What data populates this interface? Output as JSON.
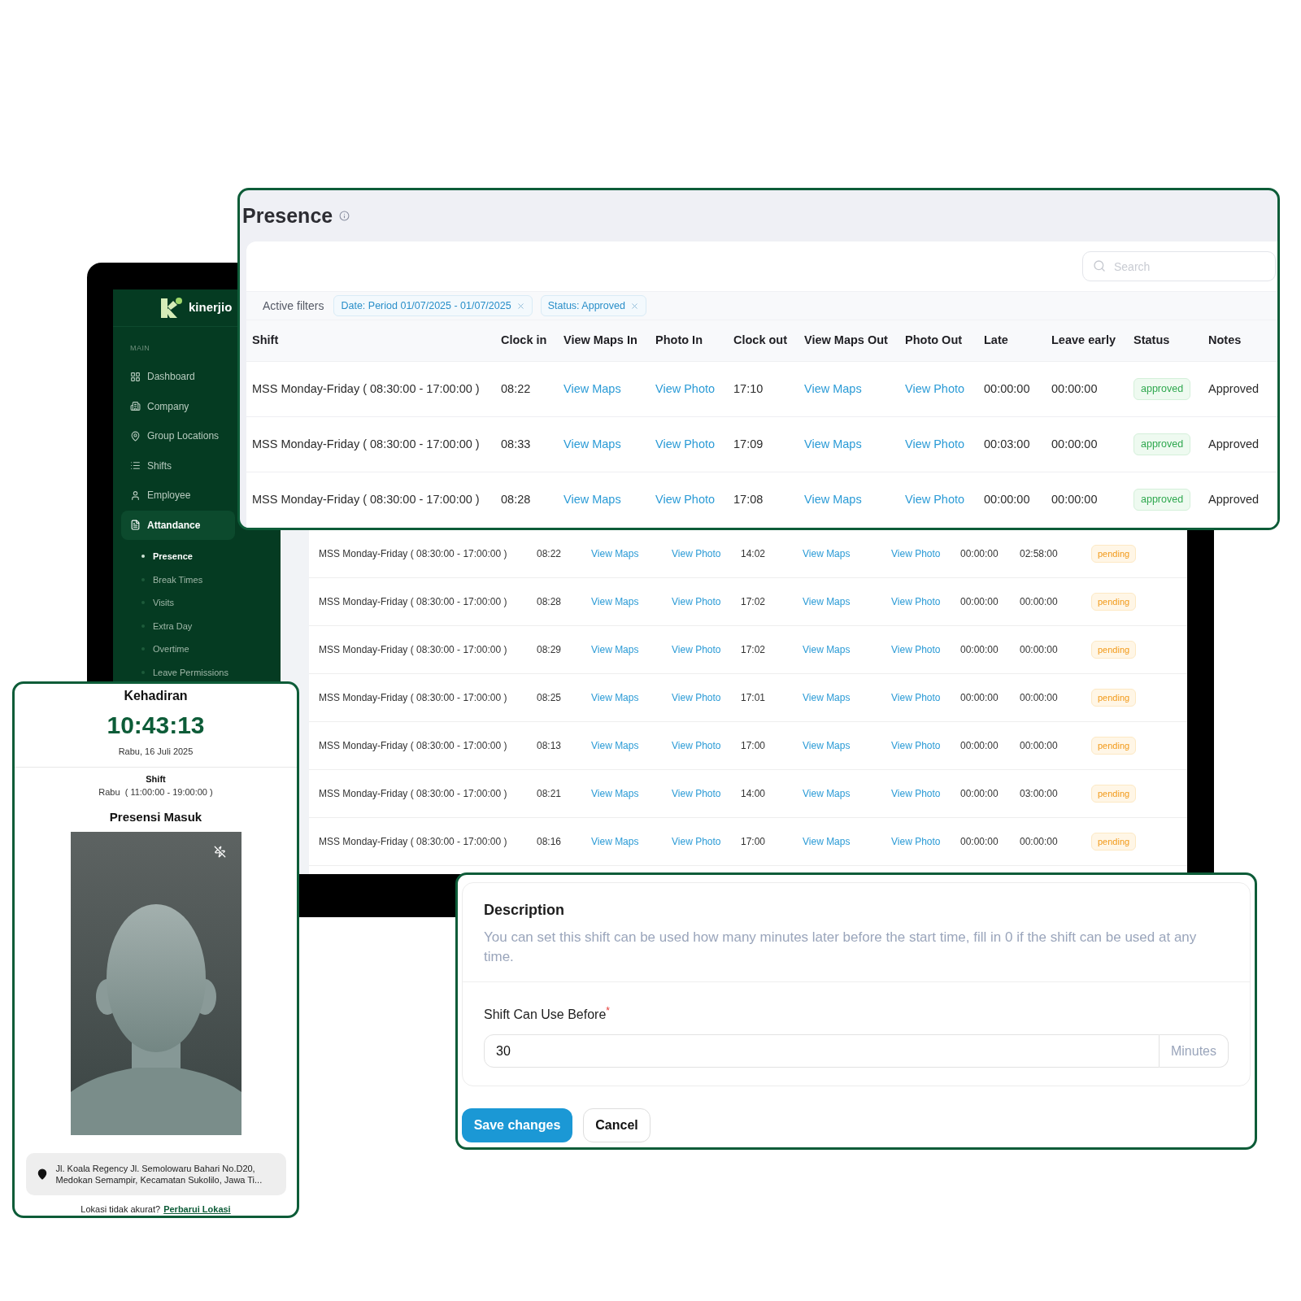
{
  "sidebar": {
    "logo": "kinerjio",
    "section": "MAIN",
    "items": [
      {
        "label": "Dashboard",
        "selected": false
      },
      {
        "label": "Company",
        "selected": false
      },
      {
        "label": "Group Locations",
        "selected": false
      },
      {
        "label": "Shifts",
        "selected": false
      },
      {
        "label": "Employee",
        "selected": false
      },
      {
        "label": "Attandance",
        "selected": true,
        "children": [
          {
            "label": "Presence",
            "selected": true
          },
          {
            "label": "Break Times",
            "selected": false
          },
          {
            "label": "Visits",
            "selected": false
          },
          {
            "label": "Extra Day",
            "selected": false
          },
          {
            "label": "Overtime",
            "selected": false
          },
          {
            "label": "Leave Permissions",
            "selected": false
          }
        ]
      }
    ]
  },
  "background_table": {
    "rows": [
      {
        "shift": "MSS Monday-Friday ( 08:30:00 - 17:00:00 )",
        "clock_in": "08:22",
        "maps_in": "View Maps",
        "photo_in": "View Photo",
        "clock_out": "14:02",
        "maps_out": "View Maps",
        "photo_out": "View Photo",
        "late": "00:00:00",
        "leave_early": "02:58:00",
        "status": {
          "label": "pending",
          "kind": "pending"
        }
      },
      {
        "shift": "MSS Monday-Friday ( 08:30:00 - 17:00:00 )",
        "clock_in": "08:28",
        "maps_in": "View Maps",
        "photo_in": "View Photo",
        "clock_out": "17:02",
        "maps_out": "View Maps",
        "photo_out": "View Photo",
        "late": "00:00:00",
        "leave_early": "00:00:00",
        "status": {
          "label": "pending",
          "kind": "pending"
        }
      },
      {
        "shift": "MSS Monday-Friday ( 08:30:00 - 17:00:00 )",
        "clock_in": "08:29",
        "maps_in": "View Maps",
        "photo_in": "View Photo",
        "clock_out": "17:02",
        "maps_out": "View Maps",
        "photo_out": "View Photo",
        "late": "00:00:00",
        "leave_early": "00:00:00",
        "status": {
          "label": "pending",
          "kind": "pending"
        }
      },
      {
        "shift": "MSS Monday-Friday ( 08:30:00 - 17:00:00 )",
        "clock_in": "08:25",
        "maps_in": "View Maps",
        "photo_in": "View Photo",
        "clock_out": "17:01",
        "maps_out": "View Maps",
        "photo_out": "View Photo",
        "late": "00:00:00",
        "leave_early": "00:00:00",
        "status": {
          "label": "pending",
          "kind": "pending"
        }
      },
      {
        "shift": "MSS Monday-Friday ( 08:30:00 - 17:00:00 )",
        "clock_in": "08:13",
        "maps_in": "View Maps",
        "photo_in": "View Photo",
        "clock_out": "17:00",
        "maps_out": "View Maps",
        "photo_out": "View Photo",
        "late": "00:00:00",
        "leave_early": "00:00:00",
        "status": {
          "label": "pending",
          "kind": "pending"
        }
      },
      {
        "shift": "MSS Monday-Friday ( 08:30:00 - 17:00:00 )",
        "clock_in": "08:21",
        "maps_in": "View Maps",
        "photo_in": "View Photo",
        "clock_out": "14:00",
        "maps_out": "View Maps",
        "photo_out": "View Photo",
        "late": "00:00:00",
        "leave_early": "03:00:00",
        "status": {
          "label": "pending",
          "kind": "pending"
        }
      },
      {
        "shift": "MSS Monday-Friday ( 08:30:00 - 17:00:00 )",
        "clock_in": "08:16",
        "maps_in": "View Maps",
        "photo_in": "View Photo",
        "clock_out": "17:00",
        "maps_out": "View Maps",
        "photo_out": "View Photo",
        "late": "00:00:00",
        "leave_early": "00:00:00",
        "status": {
          "label": "pending",
          "kind": "pending"
        }
      }
    ]
  },
  "presence_window": {
    "title": "Presence",
    "search": {
      "placeholder": "Search"
    },
    "filters_label": "Active filters",
    "filters": [
      "Date: Period 01/07/2025 - 01/07/2025",
      "Status: Approved"
    ],
    "columns": [
      "Shift",
      "Clock in",
      "View Maps In",
      "Photo In",
      "Clock out",
      "View Maps Out",
      "Photo Out",
      "Late",
      "Leave early",
      "Status",
      "Notes"
    ],
    "rows": [
      {
        "shift": "MSS Monday-Friday ( 08:30:00 - 17:00:00 )",
        "clock_in": "08:22",
        "maps_in": "View Maps",
        "photo_in": "View Photo",
        "clock_out": "17:10",
        "maps_out": "View Maps",
        "photo_out": "View Photo",
        "late": "00:00:00",
        "leave_early": "00:00:00",
        "status": {
          "label": "approved",
          "kind": "approved"
        },
        "notes": "Approved"
      },
      {
        "shift": "MSS Monday-Friday ( 08:30:00 - 17:00:00 )",
        "clock_in": "08:33",
        "maps_in": "View Maps",
        "photo_in": "View Photo",
        "clock_out": "17:09",
        "maps_out": "View Maps",
        "photo_out": "View Photo",
        "late": "00:03:00",
        "leave_early": "00:00:00",
        "status": {
          "label": "approved",
          "kind": "approved"
        },
        "notes": "Approved"
      },
      {
        "shift": "MSS Monday-Friday ( 08:30:00 - 17:00:00 )",
        "clock_in": "08:28",
        "maps_in": "View Maps",
        "photo_in": "View Photo",
        "clock_out": "17:08",
        "maps_out": "View Maps",
        "photo_out": "View Photo",
        "late": "00:00:00",
        "leave_early": "00:00:00",
        "status": {
          "label": "approved",
          "kind": "approved"
        },
        "notes": "Approved"
      }
    ]
  },
  "attendance_card": {
    "title": "Kehadiran",
    "time": "10:43:13",
    "date": "Rabu, 16 Juli 2025",
    "shift_label": "Shift",
    "shift_value": "Rabu  ( 11:00:00 - 19:00:00 )",
    "section_title": "Presensi Masuk",
    "address": "Jl. Koala Regency Jl. Semolowaru Bahari No.D20, Medokan Semampir, Kecamatan Sukolilo, Jawa Ti...",
    "location_prompt": "Lokasi tidak akurat?",
    "location_link": "Perbarui Lokasi"
  },
  "shift_form": {
    "heading": "Description",
    "description": "You can set this shift can be used how many minutes later before the start time, fill in 0 if the shift can be used at any time.",
    "field_label": "Shift Can Use Before",
    "required_mark": "*",
    "value": "30",
    "unit": "Minutes",
    "buttons": [
      {
        "label": "Save changes",
        "kind": "primary"
      },
      {
        "label": "Cancel",
        "kind": "secondary"
      }
    ]
  }
}
